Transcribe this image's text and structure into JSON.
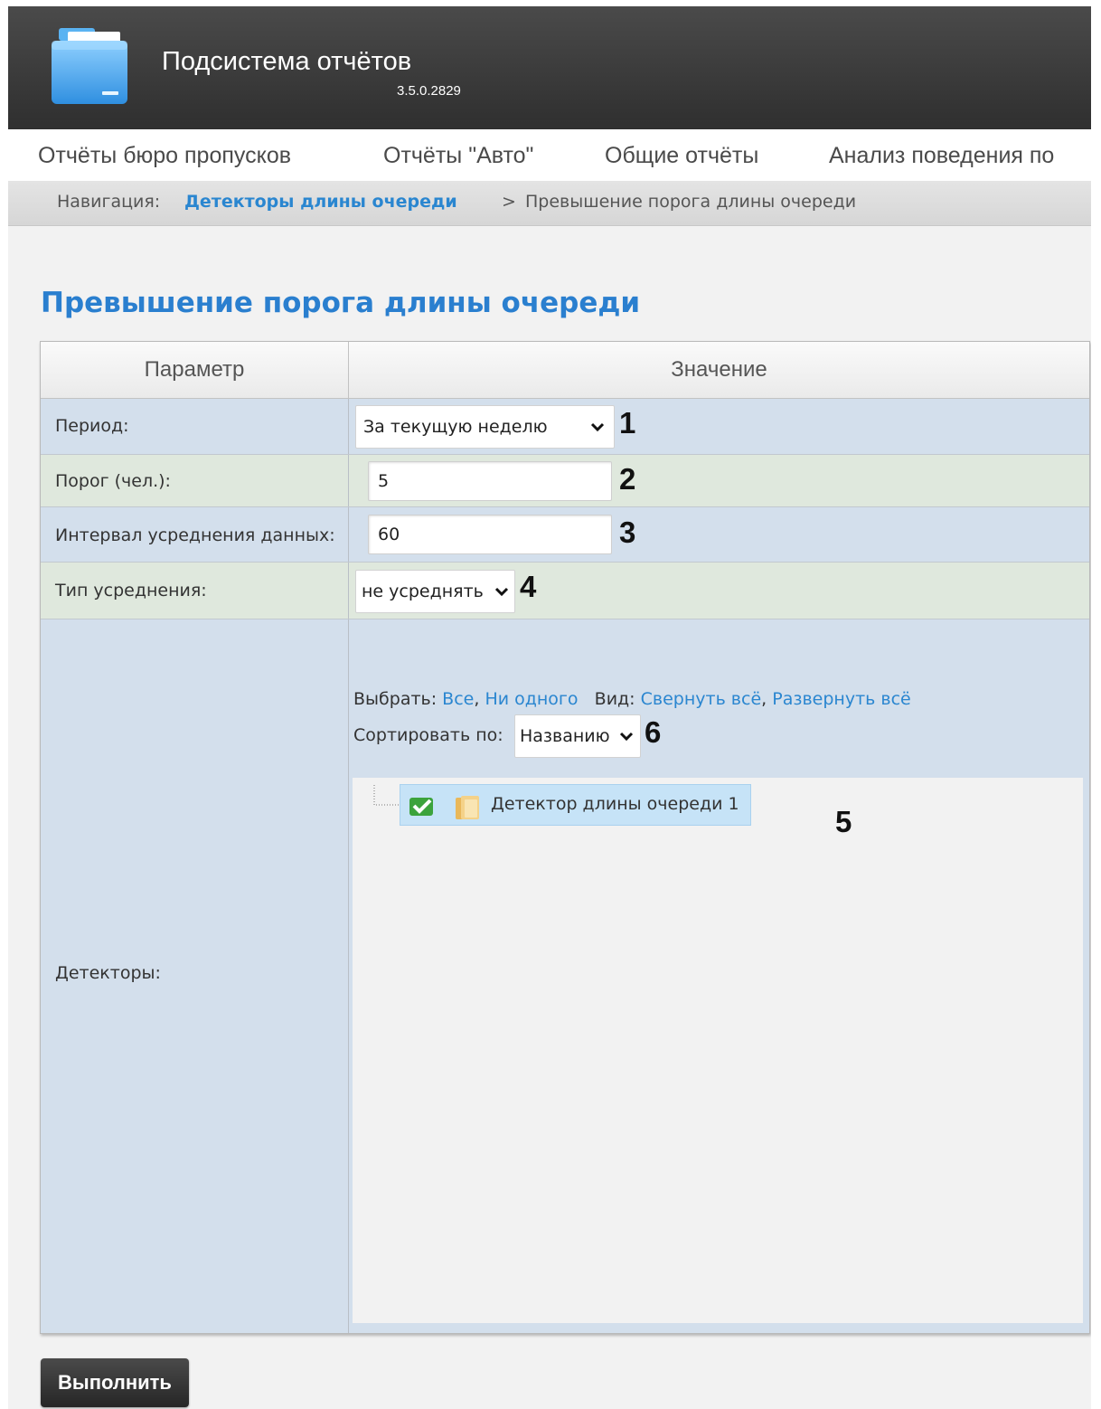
{
  "header": {
    "title": "Подсистема отчётов",
    "version": "3.5.0.2829"
  },
  "menu": {
    "items": [
      {
        "label": "Отчёты бюро пропусков"
      },
      {
        "label": "Отчёты \"Авто\""
      },
      {
        "label": "Общие отчёты"
      },
      {
        "label": "Анализ поведения по"
      }
    ]
  },
  "breadcrumb": {
    "prefix": "Навигация:",
    "link": "Детекторы длины очереди",
    "separator": ">",
    "current": "Превышение порога длины очереди"
  },
  "page": {
    "title": "Превышение порога длины очереди"
  },
  "table": {
    "col_param": "Параметр",
    "col_value": "Значение",
    "rows": {
      "period": {
        "label": "Период:",
        "value": "За текущую неделю",
        "marker": "1"
      },
      "threshold": {
        "label": "Порог (чел.):",
        "value": "5",
        "marker": "2"
      },
      "interval": {
        "label": "Интервал усреднения данных:",
        "value": "60",
        "marker": "3"
      },
      "avg_type": {
        "label": "Тип усреднения:",
        "value": "не усреднять",
        "marker": "4"
      },
      "detectors": {
        "label": "Детекторы:",
        "select_label": "Выбрать:",
        "select_all": "Все",
        "select_none": "Ни одного",
        "view_label": "Вид:",
        "collapse_all": "Свернуть всё",
        "expand_all": "Развернуть всё",
        "sort_label": "Сортировать по:",
        "sort_value": "Названию",
        "sort_marker": "6",
        "tree_marker": "5",
        "tree_items": [
          {
            "label": "Детектор длины очереди 1",
            "checked": true
          }
        ]
      }
    }
  },
  "actions": {
    "run": "Выполнить"
  },
  "colors": {
    "accent": "#2a7fcf",
    "link": "#2a86d0",
    "header_bg": "#3a3a3a",
    "row_blue": "#d3dfec",
    "row_green": "#dfe8dd",
    "tree_selected": "#c6e3f7"
  }
}
